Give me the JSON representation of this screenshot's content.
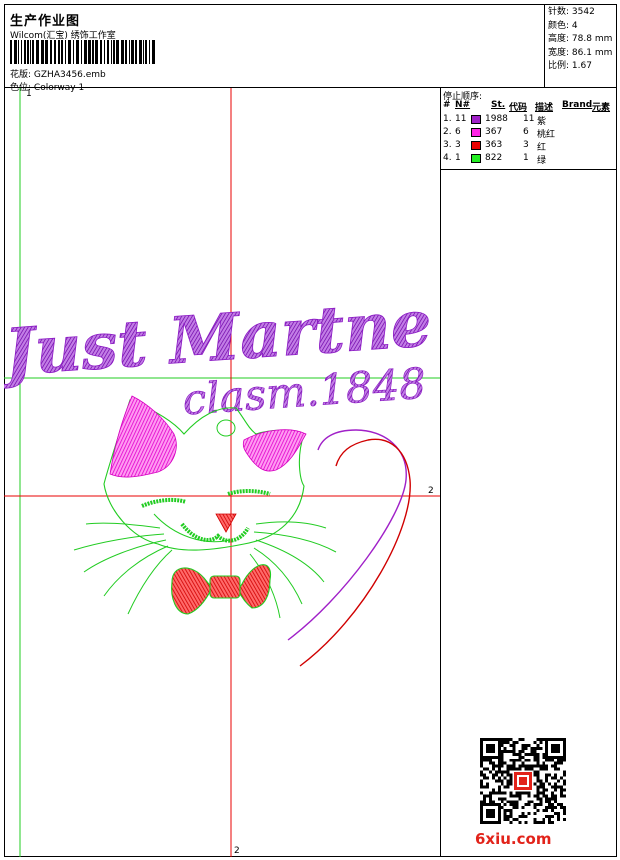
{
  "header": {
    "title": "生产作业图",
    "company": "Wilcom(汇宝) 绣饰工作室",
    "file_label": "花版:",
    "file_name": "GZHA3456.emb",
    "colorway_label": "色位:",
    "colorway": "Colorway 1"
  },
  "stats": [
    {
      "label": "针数:",
      "value": "3542"
    },
    {
      "label": "颜色:",
      "value": "4"
    },
    {
      "label": "高度:",
      "value": "78.8 mm"
    },
    {
      "label": "宽度:",
      "value": "86.1 mm"
    },
    {
      "label": "比例:",
      "value": "1.67"
    }
  ],
  "stop_sequence": {
    "title": "停止顺序:",
    "columns": [
      "#",
      "N#",
      "St.",
      "代码",
      "描述",
      "Brand",
      "元素"
    ],
    "rows": [
      {
        "index": "1.",
        "n": "11",
        "color": "#a020c8",
        "stitches": "1988",
        "code": "11",
        "desc": "紫"
      },
      {
        "index": "2.",
        "n": "6",
        "color": "#ff22e6",
        "stitches": "367",
        "code": "6",
        "desc": "桃红"
      },
      {
        "index": "3.",
        "n": "3",
        "color": "#e80000",
        "stitches": "363",
        "code": "3",
        "desc": "红"
      },
      {
        "index": "4.",
        "n": "1",
        "color": "#22ee22",
        "stitches": "822",
        "code": "1",
        "desc": "绿"
      }
    ]
  },
  "design": {
    "text_line1": "Just Martne",
    "text_line2": "clasm.1848",
    "colors": {
      "purple": "#9a1fd0",
      "pink": "#ff22e6",
      "red": "#e80000",
      "green": "#22dd22"
    }
  },
  "axes": {
    "green_v_label": "1",
    "red_h_label": "2",
    "red_v_label": "2"
  },
  "watermark": "6xiu.com"
}
